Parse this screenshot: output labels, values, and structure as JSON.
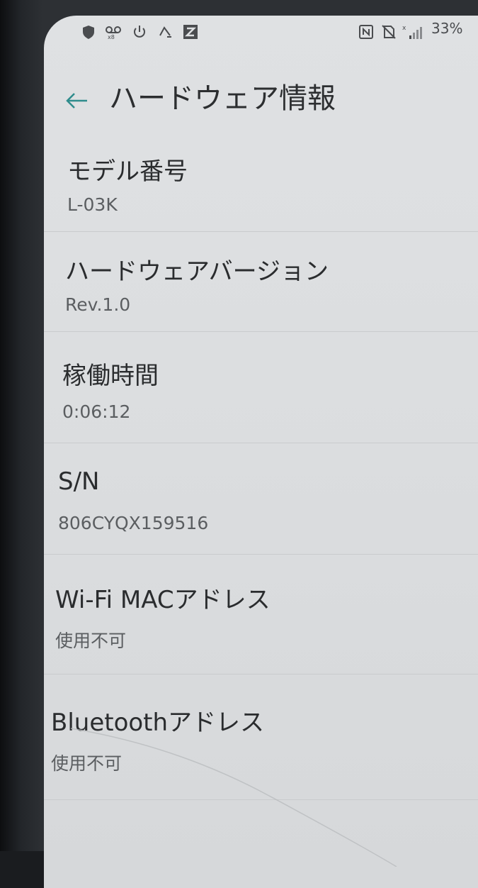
{
  "status_bar": {
    "battery": "33%",
    "icons": [
      "shield-icon",
      "voicemail-icon",
      "power-icon",
      "cast-icon",
      "app-z-icon",
      "nfc-icon",
      "no-sim-icon",
      "signal-icon"
    ]
  },
  "header": {
    "title": "ハードウェア情報",
    "back_icon": "arrow-left-icon"
  },
  "items": [
    {
      "label": "モデル番号",
      "value": "L-03K"
    },
    {
      "label": "ハードウェアバージョン",
      "value": "Rev.1.0"
    },
    {
      "label": "稼働時間",
      "value": "0:06:12"
    },
    {
      "label": "S/N",
      "value": "806CYQX159516"
    },
    {
      "label": "Wi-Fi MACアドレス",
      "value": "使用不可"
    },
    {
      "label": "Bluetoothアドレス",
      "value": "使用不可"
    }
  ],
  "colors": {
    "accent": "#2f8c8c",
    "text_primary": "#2a2c2e",
    "text_secondary": "#5b5e61",
    "background": "#dcdee0"
  }
}
